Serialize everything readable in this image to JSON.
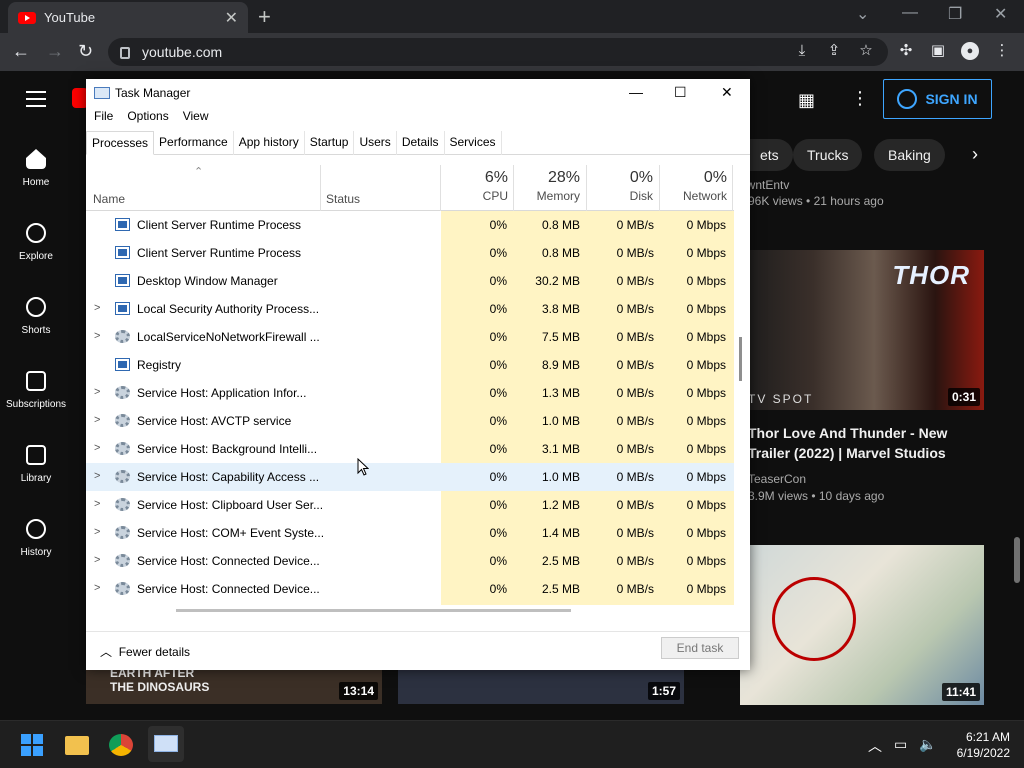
{
  "browser": {
    "tab_title": "YouTube",
    "tab_close": "✕",
    "new_tab": "+",
    "url": "youtube.com",
    "window_controls": [
      "⌄",
      "—",
      "❐",
      "✕"
    ]
  },
  "youtube": {
    "signin_label": "SIGN IN",
    "sidebar": [
      {
        "label": "Home",
        "icon": "home-icon"
      },
      {
        "label": "Explore",
        "icon": "compass-icon"
      },
      {
        "label": "Shorts",
        "icon": "shorts-icon"
      },
      {
        "label": "Subscriptions",
        "icon": "subscriptions-icon"
      },
      {
        "label": "Library",
        "icon": "library-icon"
      },
      {
        "label": "History",
        "icon": "history-icon"
      }
    ],
    "chips": [
      "ets",
      "Trucks",
      "Baking"
    ],
    "partial_meta_top": "P96K views • 21 hours ago",
    "partial_channel_top": "owntEntv",
    "video": {
      "title": "Thor Love And Thunder - New Trailer (2022) | Marvel Studios",
      "channel": "TeaserCon",
      "meta": "3.9M views • 10 days ago",
      "duration": "0:31",
      "thumb_text": "TV SPOT",
      "thumb_logo": "THOR"
    },
    "bottom_durations": [
      "13:14",
      "1:57",
      "11:41"
    ],
    "bottom_thumb_text": [
      "EARTH AFTER",
      "THE DINOSAURS"
    ]
  },
  "task_manager": {
    "title": "Task Manager",
    "menu": [
      "File",
      "Options",
      "View"
    ],
    "tabs": [
      "Processes",
      "Performance",
      "App history",
      "Startup",
      "Users",
      "Details",
      "Services"
    ],
    "active_tab": "Processes",
    "columns": {
      "name": "Name",
      "status": "Status",
      "cpu_pct": "6%",
      "cpu": "CPU",
      "mem_pct": "28%",
      "mem": "Memory",
      "disk_pct": "0%",
      "disk": "Disk",
      "net_pct": "0%",
      "net": "Network"
    },
    "rows": [
      {
        "expand": "",
        "icon": "win",
        "name": "Client Server Runtime Process",
        "cpu": "0%",
        "mem": "0.8 MB",
        "disk": "0 MB/s",
        "net": "0 Mbps"
      },
      {
        "expand": "",
        "icon": "win",
        "name": "Client Server Runtime Process",
        "cpu": "0%",
        "mem": "0.8 MB",
        "disk": "0 MB/s",
        "net": "0 Mbps"
      },
      {
        "expand": "",
        "icon": "win",
        "name": "Desktop Window Manager",
        "cpu": "0%",
        "mem": "30.2 MB",
        "disk": "0 MB/s",
        "net": "0 Mbps"
      },
      {
        "expand": ">",
        "icon": "win",
        "name": "Local Security Authority Process...",
        "cpu": "0%",
        "mem": "3.8 MB",
        "disk": "0 MB/s",
        "net": "0 Mbps"
      },
      {
        "expand": ">",
        "icon": "gear",
        "name": "LocalServiceNoNetworkFirewall ...",
        "cpu": "0%",
        "mem": "7.5 MB",
        "disk": "0 MB/s",
        "net": "0 Mbps"
      },
      {
        "expand": "",
        "icon": "win",
        "name": "Registry",
        "cpu": "0%",
        "mem": "8.9 MB",
        "disk": "0 MB/s",
        "net": "0 Mbps"
      },
      {
        "expand": ">",
        "icon": "gear",
        "name": "Service Host: Application Infor...",
        "cpu": "0%",
        "mem": "1.3 MB",
        "disk": "0 MB/s",
        "net": "0 Mbps"
      },
      {
        "expand": ">",
        "icon": "gear",
        "name": "Service Host: AVCTP service",
        "cpu": "0%",
        "mem": "1.0 MB",
        "disk": "0 MB/s",
        "net": "0 Mbps"
      },
      {
        "expand": ">",
        "icon": "gear",
        "name": "Service Host: Background Intelli...",
        "cpu": "0%",
        "mem": "3.1 MB",
        "disk": "0 MB/s",
        "net": "0 Mbps"
      },
      {
        "expand": ">",
        "icon": "gear",
        "name": "Service Host: Capability Access ...",
        "cpu": "0%",
        "mem": "1.0 MB",
        "disk": "0 MB/s",
        "net": "0 Mbps"
      },
      {
        "expand": ">",
        "icon": "gear",
        "name": "Service Host: Clipboard User Ser...",
        "cpu": "0%",
        "mem": "1.2 MB",
        "disk": "0 MB/s",
        "net": "0 Mbps"
      },
      {
        "expand": ">",
        "icon": "gear",
        "name": "Service Host: COM+ Event Syste...",
        "cpu": "0%",
        "mem": "1.4 MB",
        "disk": "0 MB/s",
        "net": "0 Mbps"
      },
      {
        "expand": ">",
        "icon": "gear",
        "name": "Service Host: Connected Device...",
        "cpu": "0%",
        "mem": "2.5 MB",
        "disk": "0 MB/s",
        "net": "0 Mbps"
      },
      {
        "expand": ">",
        "icon": "gear",
        "name": "Service Host: Connected Device...",
        "cpu": "0%",
        "mem": "2.5 MB",
        "disk": "0 MB/s",
        "net": "0 Mbps"
      }
    ],
    "highlighted_row": 9,
    "fewer_details": "Fewer details",
    "end_task": "End task"
  },
  "taskbar": {
    "time": "6:21 AM",
    "date": "6/19/2022",
    "apps": [
      "start-icon",
      "file-explorer-icon",
      "chrome-icon",
      "task-manager-icon"
    ]
  },
  "colors": {
    "yt_bg": "#0f0f0f",
    "accent_blue": "#3ea6ff",
    "tm_highlight": "#fff4c4",
    "row_hover": "#e5f1fb"
  }
}
